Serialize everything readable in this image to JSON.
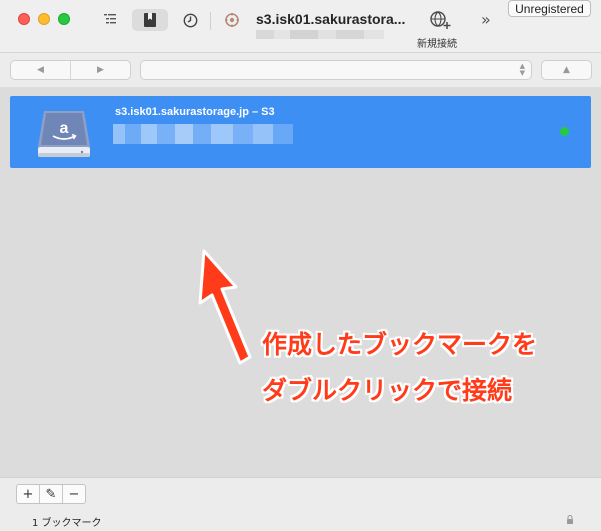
{
  "window": {
    "title": "s3.isk01.sakurastora...",
    "registration_label": "Unregistered"
  },
  "toolbar": {
    "items": [
      {
        "icon": "outline-view-icon"
      },
      {
        "icon": "bookmarks-icon",
        "selected": true
      },
      {
        "icon": "history-clock-icon"
      },
      {
        "icon": "transfers-icon"
      }
    ],
    "new_connection_label": "新規接続",
    "overflow_glyph": "»"
  },
  "pathbar": {
    "back_glyph": "◀",
    "forward_glyph": "▶",
    "up_glyph": "▲",
    "path_value": ""
  },
  "bookmarks": [
    {
      "name": "s3.isk01.sakurastorage.jp – S3",
      "icon": "amazon-s3-drive-icon",
      "status": "connected",
      "status_color": "#27c93f"
    }
  ],
  "annotation": {
    "line1": "作成したブックマークを",
    "line2": "ダブルクリックで接続",
    "color": "#ff3b1a"
  },
  "bottom_buttons": [
    {
      "glyph": "+"
    },
    {
      "glyph": "✎"
    },
    {
      "glyph": "−"
    }
  ],
  "status": {
    "count_text": "1 ブックマーク"
  },
  "colors": {
    "selection": "#3d8ff4",
    "list_background": "#dcdcdc"
  }
}
